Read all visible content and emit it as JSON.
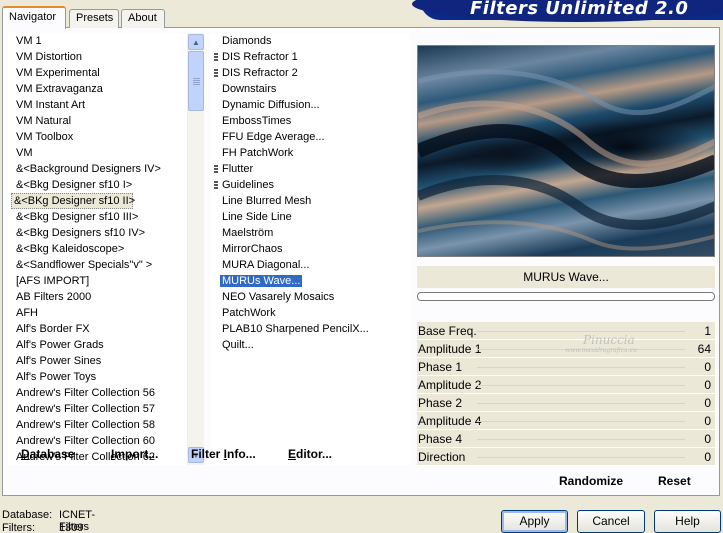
{
  "window": {
    "title": "Filters Unlimited 2.0"
  },
  "tabs": [
    {
      "label": "Navigator",
      "active": true
    },
    {
      "label": "Presets",
      "active": false
    },
    {
      "label": "About",
      "active": false
    }
  ],
  "categories": {
    "items": [
      "VM 1",
      "VM Distortion",
      "VM Experimental",
      "VM Extravaganza",
      "VM Instant Art",
      "VM Natural",
      "VM Toolbox",
      "VM",
      "&<Background Designers IV>",
      "&<Bkg Designer sf10 I>",
      "&<BKg Designer sf10 II>",
      "&<Bkg Designer sf10 III>",
      "&<Bkg Designers sf10 IV>",
      "&<Bkg Kaleidoscope>",
      "&<Sandflower Specials\"v\" >",
      "[AFS IMPORT]",
      "AB Filters 2000",
      "AFH",
      "Alf's Border FX",
      "Alf's Power Grads",
      "Alf's Power Sines",
      "Alf's Power Toys",
      "Andrew's Filter Collection 56",
      "Andrew's Filter Collection 57",
      "Andrew's Filter Collection 58",
      "Andrew's Filter Collection 60",
      "Andrew's Filter Collection 62"
    ],
    "selected_index": 10
  },
  "filters": {
    "items": [
      {
        "label": "Diamonds",
        "grip": false
      },
      {
        "label": "DIS Refractor 1",
        "grip": true
      },
      {
        "label": "DIS Refractor 2",
        "grip": true
      },
      {
        "label": "Downstairs",
        "grip": false
      },
      {
        "label": "Dynamic Diffusion...",
        "grip": false
      },
      {
        "label": "EmbossTimes",
        "grip": false
      },
      {
        "label": "FFU Edge Average...",
        "grip": false
      },
      {
        "label": "FH PatchWork",
        "grip": false
      },
      {
        "label": "Flutter",
        "grip": true
      },
      {
        "label": "Guidelines",
        "grip": true
      },
      {
        "label": "Line Blurred Mesh",
        "grip": false
      },
      {
        "label": "Line Side Line",
        "grip": false
      },
      {
        "label": "Maelström",
        "grip": false
      },
      {
        "label": "MirrorChaos",
        "grip": false
      },
      {
        "label": "MURA Diagonal...",
        "grip": false
      },
      {
        "label": "MURUs Wave...",
        "grip": false
      },
      {
        "label": "NEO Vasarely Mosaics",
        "grip": false
      },
      {
        "label": "PatchWork",
        "grip": false
      },
      {
        "label": "PLAB10 Sharpened PencilX...",
        "grip": false
      },
      {
        "label": "Quilt...",
        "grip": false
      }
    ],
    "selected_index": 15
  },
  "panel_buttons": {
    "database": {
      "u": "D",
      "rest": "atabase"
    },
    "import": {
      "u": "I",
      "rest": "mport..."
    },
    "filter_info": {
      "pre": "Filter ",
      "u": "I",
      "rest": "nfo..."
    },
    "editor": {
      "u": "E",
      "rest": "ditor..."
    }
  },
  "selected_filter_name": "MURUs Wave...",
  "params": [
    {
      "name": "Base Freq.",
      "value": "1"
    },
    {
      "name": "Amplitude 1",
      "value": "64"
    },
    {
      "name": "Phase 1",
      "value": "0"
    },
    {
      "name": "Amplitude 2",
      "value": "0"
    },
    {
      "name": "Phase 2",
      "value": "0"
    },
    {
      "name": "Amplitude 4",
      "value": "0"
    },
    {
      "name": "Phase 4",
      "value": "0"
    },
    {
      "name": "Direction",
      "value": "0"
    }
  ],
  "watermark": {
    "name": "Pinuccia",
    "site": "www.maxidragrafica.eu"
  },
  "actions": {
    "randomize": "Randomize",
    "reset": "Reset"
  },
  "status": {
    "database_label": "Database:",
    "database_value": "ICNET-Filters",
    "filters_label": "Filters:",
    "filters_value": "1309"
  },
  "dialog_buttons": {
    "apply": "Apply",
    "cancel": "Cancel",
    "help": "Help"
  },
  "colors": {
    "banner": "#0a2a8a",
    "selection": "#316ac5",
    "tab_accent": "#e68b2c",
    "face": "#ece9d8"
  }
}
